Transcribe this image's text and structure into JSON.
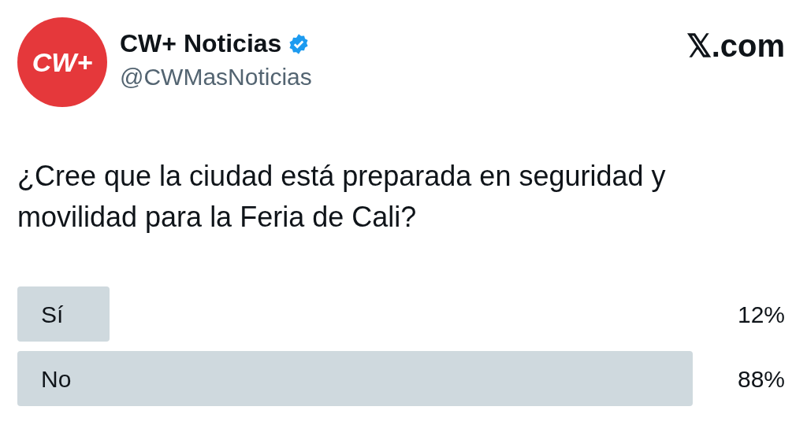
{
  "account": {
    "logo_text": "CW+",
    "name": "CW+ Noticias",
    "verified": true,
    "handle": "@CWMasNoticias"
  },
  "site": "𝕏.com",
  "question": "¿Cree que la ciudad está preparada en seguridad y movilidad para la Feria de Cali?",
  "poll": [
    {
      "label": "Sí",
      "percent": "12%"
    },
    {
      "label": "No",
      "percent": "88%"
    }
  ]
}
